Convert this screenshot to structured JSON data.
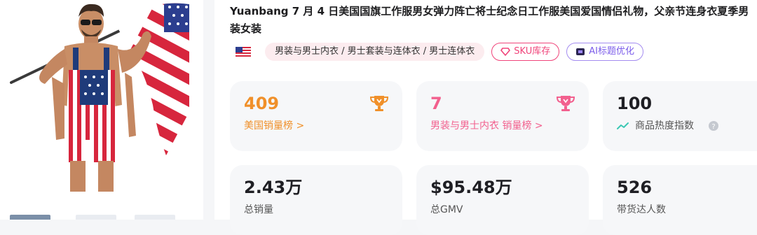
{
  "product": {
    "title": "Yuanbang 7 月 4 日美国国旗工作服男女弹力阵亡将士纪念日工作服美国爱国情侣礼物，父亲节连身衣夏季男装女装",
    "category": "男装与男士内衣 / 男士套装与连体衣 / 男士连体衣",
    "sku_button": "SKU库存",
    "ai_button": "AI标题优化"
  },
  "stats": {
    "country_rank": {
      "value": "409",
      "label": "美国销量榜 >"
    },
    "category_rank": {
      "value": "7",
      "label": "男装与男士内衣 销量榜 >"
    },
    "heat": {
      "value": "100",
      "label": "商品热度指数"
    },
    "total_sales": {
      "value": "2.43万",
      "label": "总销量"
    },
    "total_gmv": {
      "value": "$95.48万",
      "label": "总GMV"
    },
    "influencers": {
      "value": "526",
      "label": "带货达人数"
    }
  },
  "icons": {
    "flag": "us-flag-icon",
    "sku": "diamond-icon",
    "ai": "ai-icon",
    "trophy": "trophy-icon",
    "trend": "trend-up-icon",
    "help": "help-icon"
  },
  "colors": {
    "rank_orange": "#f0902a",
    "rank_pink": "#f2608e",
    "sku_accent": "#f0447a",
    "ai_accent": "#7b5cea",
    "trend_teal": "#3cc8b4"
  }
}
